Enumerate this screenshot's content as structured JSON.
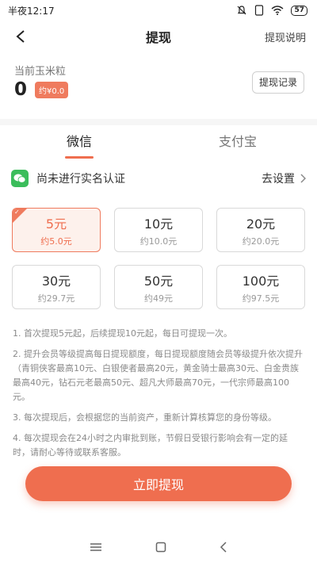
{
  "status_bar": {
    "time": "半夜12:17",
    "battery": "57"
  },
  "nav": {
    "title": "提现",
    "right_link": "提现说明"
  },
  "balance": {
    "label": "当前玉米粒",
    "value": "0",
    "approx": "约¥0.0",
    "record_button": "提现记录"
  },
  "tabs": [
    {
      "label": "微信",
      "active": true
    },
    {
      "label": "支付宝",
      "active": false
    }
  ],
  "auth": {
    "text": "尚未进行实名认证",
    "link": "去设置"
  },
  "amounts": [
    {
      "value": "5元",
      "approx": "约5.0元",
      "selected": true
    },
    {
      "value": "10元",
      "approx": "约10.0元",
      "selected": false
    },
    {
      "value": "20元",
      "approx": "约20.0元",
      "selected": false
    },
    {
      "value": "30元",
      "approx": "约29.7元",
      "selected": false
    },
    {
      "value": "50元",
      "approx": "约49元",
      "selected": false
    },
    {
      "value": "100元",
      "approx": "约97.5元",
      "selected": false
    }
  ],
  "rules": [
    "1. 首次提现5元起，后续提现10元起，每日可提现一次。",
    "2. 提升会员等级提高每日提现额度，每日提现额度随会员等级提升依次提升（青铜侠客最高10元、白银使者最高20元，黄金骑士最高30元、白金贵族最高40元，钻石元老最高50元、超凡大师最高70元，一代宗师最高100元。",
    "3. 每次提现后，会根据您的当前资产，重新计算核算您的身份等级。",
    "4. 每次提现会在24小时之内审批到账，节假日受银行影响会有一定的延时，请耐心等待或联系客服。"
  ],
  "cta": "立即提现",
  "colors": {
    "accent": "#ef6e4f",
    "wechat": "#3bbd5b"
  }
}
